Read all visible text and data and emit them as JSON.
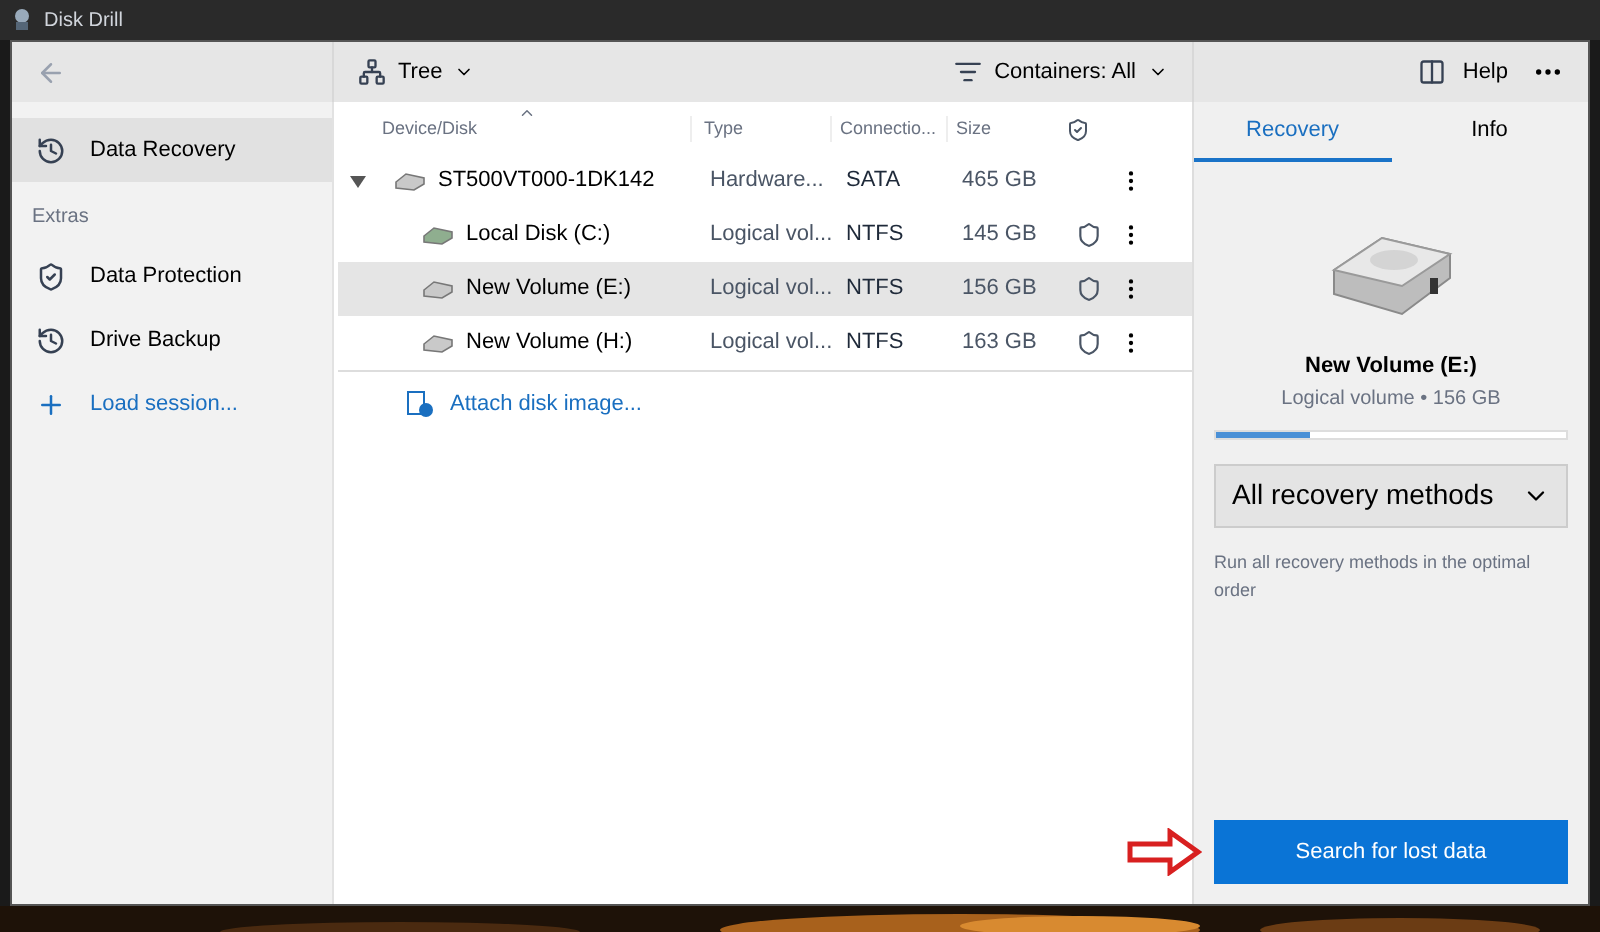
{
  "window": {
    "title": "Disk Drill"
  },
  "sidebar": {
    "items": [
      {
        "label": "Data Recovery",
        "selected": true,
        "kind": "recovery"
      }
    ],
    "section": "Extras",
    "extras": [
      {
        "label": "Data Protection",
        "selected": false,
        "kind": "protection"
      },
      {
        "label": "Drive Backup",
        "selected": false,
        "kind": "backup"
      }
    ],
    "load_session": "Load session..."
  },
  "toolbar": {
    "view": "Tree",
    "filter": "Containers: All",
    "help": "Help"
  },
  "table": {
    "columns": [
      "Device/Disk",
      "Type",
      "Connectio...",
      "Size"
    ],
    "rows": [
      {
        "name": "ST500VT000-1DK142",
        "type": "Hardware...",
        "connection": "SATA",
        "size": "465 GB",
        "expanded": true,
        "shield": false,
        "selected": false,
        "children": [
          {
            "name": "Local Disk (C:)",
            "type": "Logical vol...",
            "connection": "NTFS",
            "size": "145 GB",
            "shield": true,
            "selected": false,
            "kind": "system"
          },
          {
            "name": "New Volume (E:)",
            "type": "Logical vol...",
            "connection": "NTFS",
            "size": "156 GB",
            "shield": true,
            "selected": true,
            "kind": "volume"
          },
          {
            "name": "New Volume (H:)",
            "type": "Logical vol...",
            "connection": "NTFS",
            "size": "163 GB",
            "shield": true,
            "selected": false,
            "kind": "volume"
          }
        ]
      }
    ],
    "attach": "Attach disk image..."
  },
  "panel": {
    "tabs": [
      {
        "label": "Recovery",
        "selected": true
      },
      {
        "label": "Info",
        "selected": false
      }
    ],
    "disk_name": "New Volume (E:)",
    "disk_info": "Logical volume • 156 GB",
    "level": 0.27,
    "method": "All recovery methods",
    "description": "Run all recovery methods in the optimal order",
    "button": "Search for lost data"
  }
}
